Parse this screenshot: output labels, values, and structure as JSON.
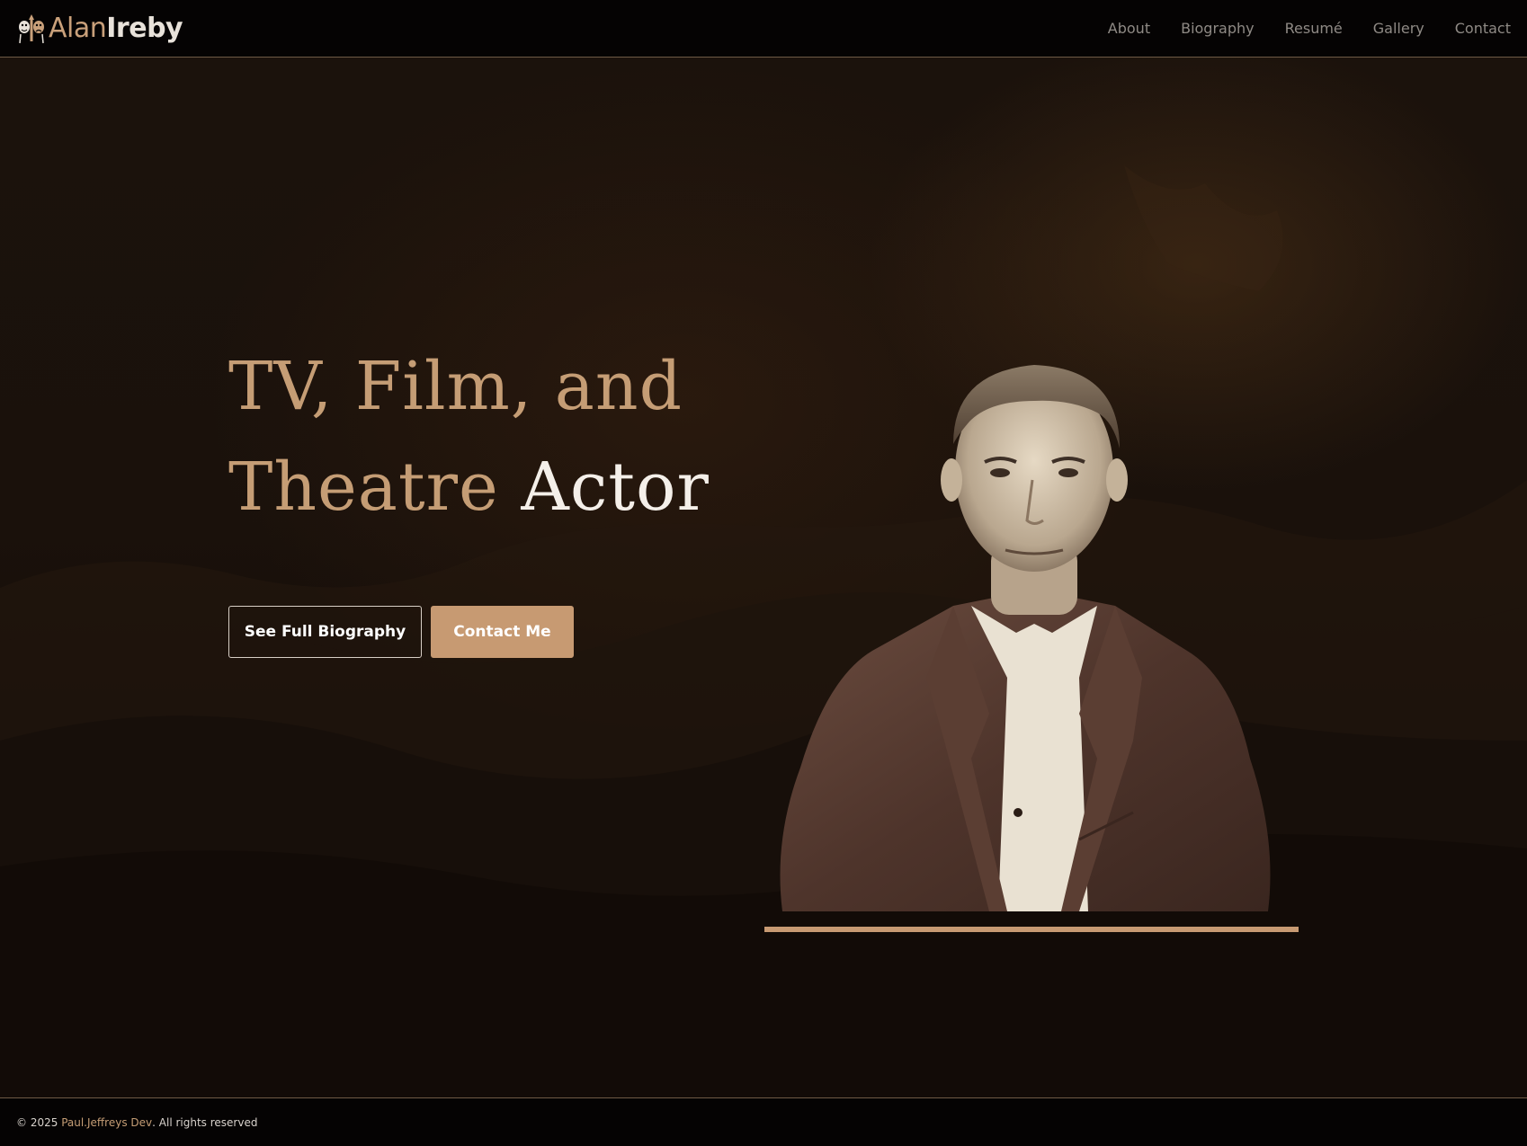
{
  "brand": {
    "first_name": "Alan",
    "last_name": "Ireby",
    "logo_icon": "theatre-masks-logo-icon"
  },
  "nav": {
    "items": [
      {
        "label": "About"
      },
      {
        "label": "Biography"
      },
      {
        "label": "Resumé"
      },
      {
        "label": "Gallery"
      },
      {
        "label": "Contact"
      }
    ]
  },
  "hero": {
    "headline_line1": "TV, Film, and",
    "headline_line2_prefix": "Theatre",
    "headline_line2_accent": "Actor",
    "primary_button": "See Full Biography",
    "secondary_button": "Contact Me",
    "portrait_icon": "actor-portrait-photo"
  },
  "footer": {
    "copyright": "© 2025",
    "author": "Paul.Jeffreys Dev",
    "rights": ". All rights reserved"
  },
  "colors": {
    "accent": "#c79a72",
    "nav_text": "#8f8a85",
    "background": "#1a110b",
    "bar": "#050303"
  }
}
